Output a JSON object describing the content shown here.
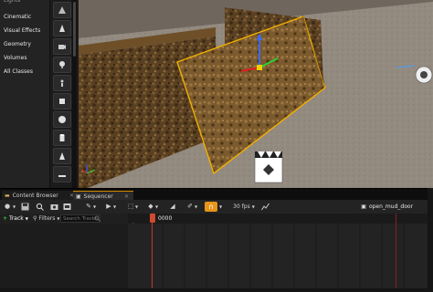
{
  "modes_panel": {
    "categories": [
      "Lights",
      "Cinematic",
      "Visual Effects",
      "Geometry",
      "Volumes",
      "All Classes"
    ]
  },
  "viewport": {
    "axis_labels": {
      "x": "X",
      "z": "Z"
    }
  },
  "tabs": [
    {
      "label": "Content Browser",
      "icon": "folder-icon"
    },
    {
      "label": "Sequencer",
      "icon": "film-icon"
    }
  ],
  "toolbar": {
    "framerate": "30 fps",
    "sequence_name": "open_mud_door",
    "accent_color": "#e6941a"
  },
  "track_bar": {
    "add_track_label": "Track",
    "filters_label": "Filters",
    "search_placeholder": "Search Tracks"
  },
  "timeline": {
    "current_frame": "0000",
    "playhead_color": "#cd4a2e"
  }
}
